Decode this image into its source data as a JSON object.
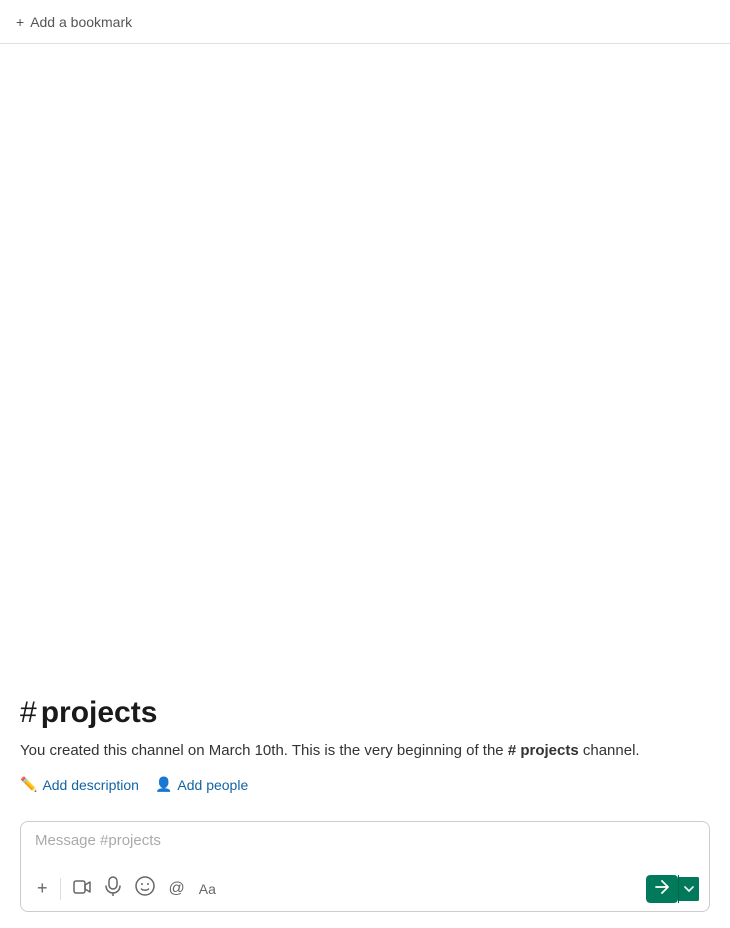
{
  "bookmark_bar": {
    "icon": "+",
    "label": "Add a bookmark"
  },
  "channel": {
    "hash": "#",
    "name": "projects",
    "creation_text_part1": "You created this channel on March 10th. This is the very beginning of the ",
    "creation_text_bold": "# projects",
    "creation_text_part2": " channel.",
    "add_description_label": "Add description",
    "add_people_label": "Add people"
  },
  "message_input": {
    "placeholder": "Message #projects"
  },
  "toolbar": {
    "add_icon": "+",
    "video_icon": "▭",
    "mic_icon": "🎤",
    "emoji_icon": "☺",
    "mention_icon": "@",
    "format_icon": "Aa",
    "send_icon": "▶",
    "more_icon": "∨"
  }
}
